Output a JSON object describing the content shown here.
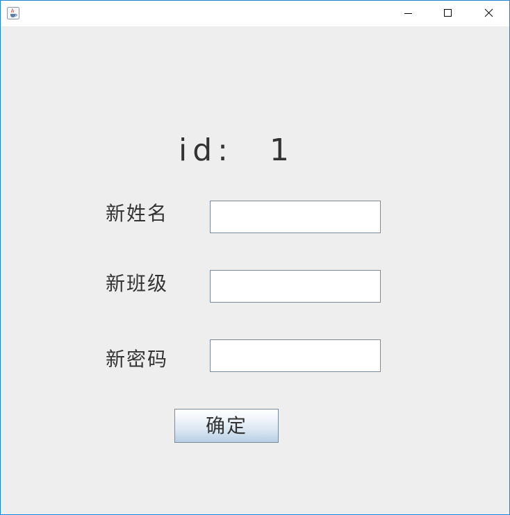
{
  "window": {
    "title": "",
    "controls": [
      "minimize",
      "maximize",
      "close"
    ]
  },
  "icons": {
    "app": "java-coffee-cup-icon",
    "minimize": "minimize-icon",
    "maximize": "maximize-icon",
    "close": "close-icon"
  },
  "colors": {
    "window_border": "#1883d7",
    "background": "#eeeeee",
    "text": "#333333",
    "field_border": "#7a8a99"
  },
  "form": {
    "id_label": "id:",
    "id_value": "1",
    "name_label": "新姓名",
    "name_value": "",
    "class_label": "新班级",
    "class_value": "",
    "password_label": "新密码",
    "password_value": "",
    "confirm_label": "确定"
  }
}
